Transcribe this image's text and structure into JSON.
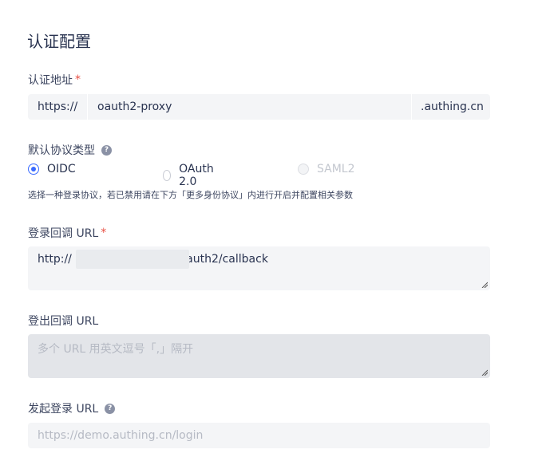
{
  "section_title": "认证配置",
  "auth_address": {
    "label": "认证地址",
    "required_mark": "*",
    "prefix": "https://",
    "value": "oauth2-proxy",
    "suffix": ".authing.cn"
  },
  "protocol": {
    "label": "默认协议类型",
    "help_icon": "question-circle-icon",
    "options": [
      {
        "label": "OIDC",
        "state": "checked"
      },
      {
        "label": "OAuth 2.0",
        "state": "unchecked"
      },
      {
        "label": "SAML2",
        "state": "disabled"
      }
    ],
    "hint": "选择一种登录协议，若已禁用请在下方「更多身份协议」内进行开启并配置相关参数"
  },
  "login_callback": {
    "label": "登录回调 URL",
    "required_mark": "*",
    "value_start": "http://",
    "value_end": "/oauth2/callback"
  },
  "logout_callback": {
    "label": "登出回调 URL",
    "placeholder": "多个 URL 用英文逗号「,」隔开"
  },
  "initiate_login": {
    "label": "发起登录 URL",
    "help_icon": "question-circle-icon",
    "placeholder": "https://demo.authing.cn/login"
  },
  "colors": {
    "accent": "#396aff",
    "required": "#e84f43",
    "field_bg": "#f4f5f7",
    "disabled_field_bg": "#e3e5e9"
  }
}
